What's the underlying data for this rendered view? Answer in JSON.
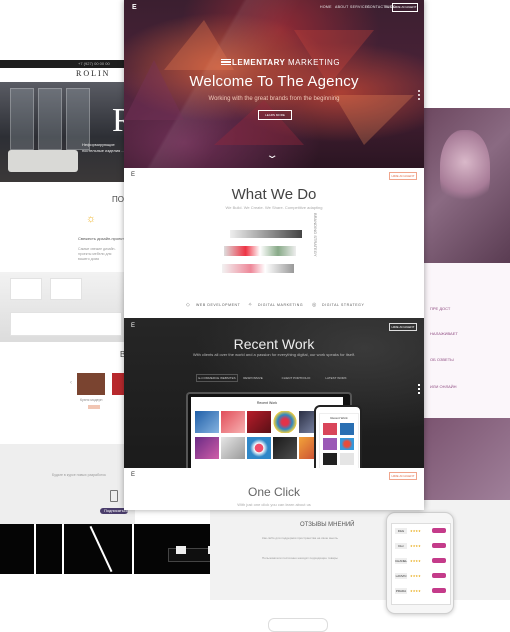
{
  "left_site": {
    "brand": "ROLIN",
    "phone": "+7 (927) 00 00 00",
    "hero_letter": "R",
    "hero_text": "Неформирующие постельные изделия ...",
    "section_title": "ПОЧЕ",
    "feature_title": "Свежесть дизайн-проектов",
    "feature_text": "Самые свежие дизайн-проекты мебели для вашего дома",
    "section2_title": "В",
    "product_label": "Кухня модерн",
    "gray_text": "Будьте в курсе новых разработок",
    "pill_label": "Подписаться"
  },
  "right_site": {
    "items": [
      "ПРЕ ДОСТ",
      "НАЛАЖИВАЕТ",
      "ОБ ОЗВЕТЫ",
      "ИЛИ ОНЛАЙН"
    ],
    "section_title": "ОТЗЫВЫ МНЕНИЙ",
    "section_text1": "Как-либо для поддержки пространства на свою мысль",
    "section_text2": "Пользователи постоянно находят подходящие товары",
    "phone_brands": [
      "D&G",
      "Dior",
      "CHANEL",
      "LANVIN",
      "PRADA"
    ]
  },
  "main": {
    "nav": {
      "logo": "E",
      "items": [
        "HOME",
        "ABOUT",
        "SERVICES",
        "CONTACT US",
        "BLOG"
      ],
      "button": "HIRE AN AGENT"
    },
    "hero": {
      "brand_bold": "LEMENTARY",
      "brand_thin": "MARKETING",
      "title": "Welcome To The Agency",
      "subtitle": "Working with the great brands from the beginning",
      "button": "LEARN MORE"
    },
    "what_we_do": {
      "logo": "E",
      "button": "HIRE AN AGENT",
      "title": "What We Do",
      "subtitle": "We Build. We Create. We Share. Competitive adapting",
      "side_label": "BRANDING STRATEGY",
      "services": [
        "WEB DEVELOPMENT",
        "DIGITAL MARKETING",
        "DIGITAL STRATEGY"
      ]
    },
    "recent_work": {
      "logo": "E",
      "button": "HIRE AN AGENT",
      "title": "Recent Work",
      "subtitle": "With clients all over the world and a passion for everything digital, our work speaks for itself.",
      "filters": [
        "E-COMMERCE WEBSITES",
        "RESPONSIVE",
        "CLIENT PORTFOLIO",
        "LATEST WORK"
      ],
      "laptop_heading": "Recent Work",
      "phone_heading": "Recent Work"
    },
    "one_click": {
      "logo": "E",
      "button": "HIRE AN AGENT",
      "title": "One Click",
      "subtitle": "With just one click you can learn about us"
    }
  },
  "colors": {
    "accent_orange": "#e06f4a",
    "right_purple": "#8e4b80",
    "dark_section": "#1f1f1f"
  }
}
